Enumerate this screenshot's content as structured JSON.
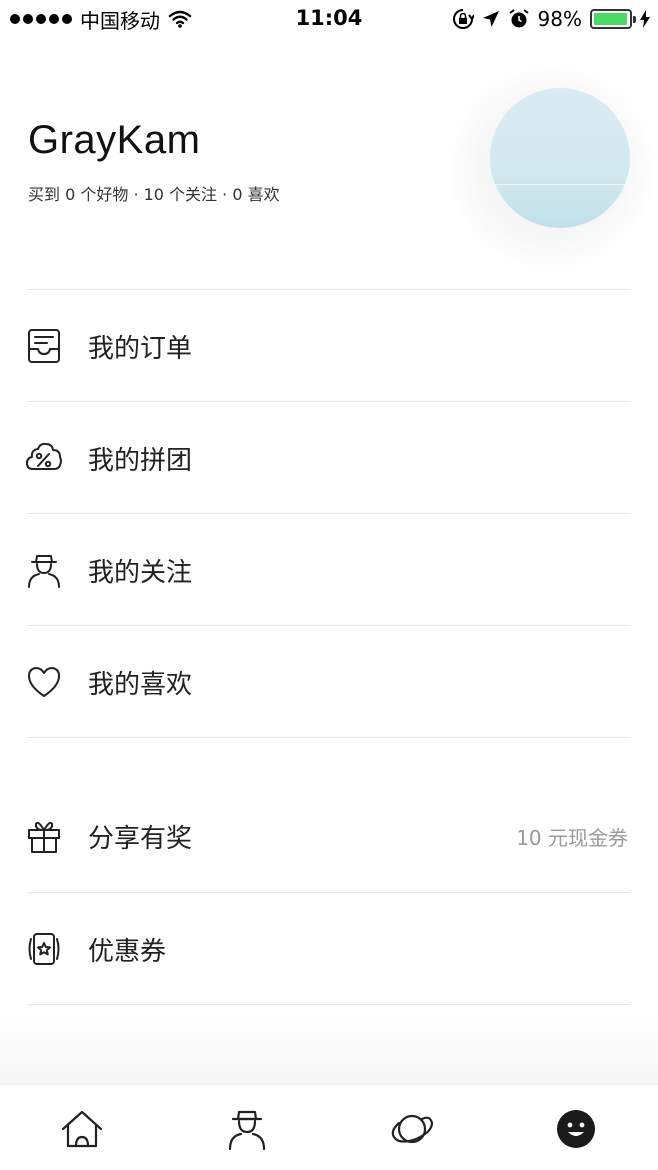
{
  "status_bar": {
    "carrier": "中国移动",
    "time": "11:04",
    "battery_percent": "98%",
    "battery_level": 0.98,
    "icons": [
      "signal-icon",
      "wifi-icon",
      "orientation-lock-icon",
      "location-icon",
      "alarm-icon",
      "battery-icon",
      "charging-icon"
    ]
  },
  "profile": {
    "username": "GrayKam",
    "stats": "买到 0 个好物 · 10 个关注 · 0 喜欢"
  },
  "menu": [
    {
      "label": "我的订单",
      "icon": "orders-icon"
    },
    {
      "label": "我的拼团",
      "icon": "group-buy-icon"
    },
    {
      "label": "我的关注",
      "icon": "following-icon"
    },
    {
      "label": "我的喜欢",
      "icon": "heart-icon"
    },
    {
      "label": "分享有奖",
      "icon": "gift-icon",
      "extra": "10 元现金券"
    },
    {
      "label": "优惠券",
      "icon": "coupon-icon"
    }
  ],
  "tab_bar": {
    "tabs": [
      "home-icon",
      "person-icon",
      "planet-icon",
      "smiley-icon"
    ],
    "active": "smiley-icon"
  }
}
